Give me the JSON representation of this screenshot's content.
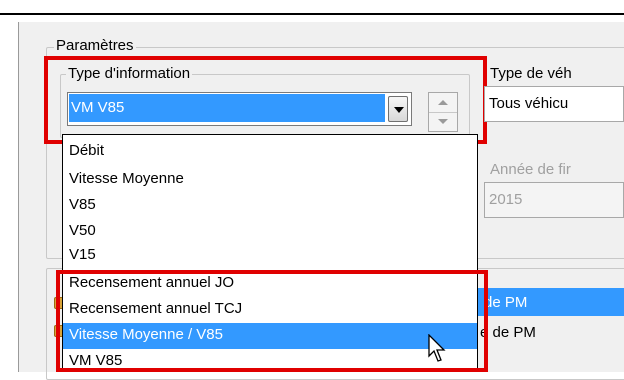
{
  "parametres": {
    "title": "Paramètres"
  },
  "type_info": {
    "title": "Type d'information",
    "selected_value": "VM V85",
    "options": [
      "Débit",
      "Vitesse Moyenne",
      "V85",
      "V50",
      "V15",
      "Recensement annuel JO",
      "Recensement annuel TCJ",
      "Vitesse Moyenne / V85",
      "VM V85"
    ],
    "highlighted": "Vitesse Moyenne / V85"
  },
  "type_vehicule": {
    "title": "Type de véh",
    "value": "Tous véhicu"
  },
  "annee_fin": {
    "title": "Année de fir",
    "value": "2015"
  },
  "right_list": {
    "item1": "de PM",
    "item2": "e de PM"
  },
  "icons": {
    "dropdown_arrow": "chevron-down-icon",
    "spin_up": "arrow-up-icon",
    "spin_down": "arrow-down-icon",
    "lock": "lock-icon",
    "cursor": "mouse-pointer-icon"
  },
  "colors": {
    "selection": "#3399ff",
    "highlight_box": "#e00000"
  }
}
